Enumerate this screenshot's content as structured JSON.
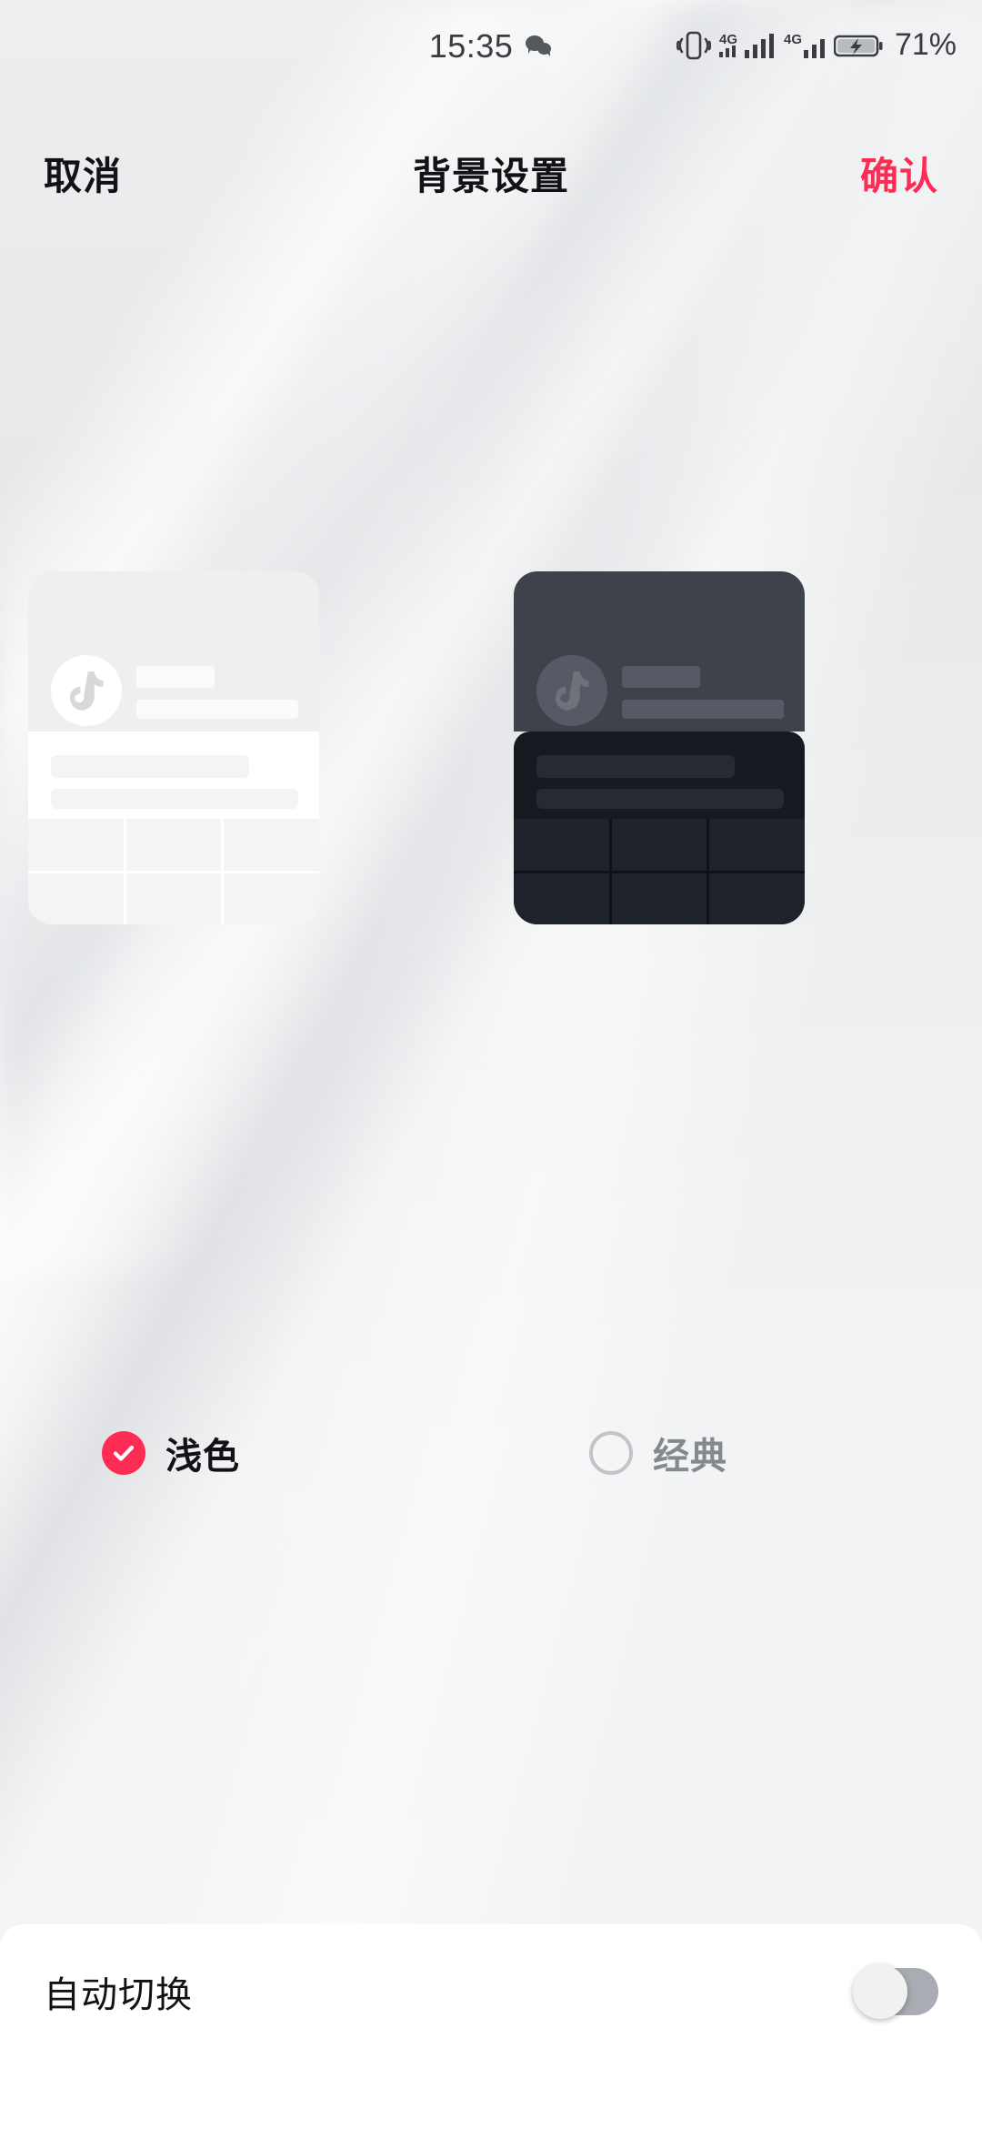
{
  "status_bar": {
    "time": "15:35",
    "battery_percent": "71%",
    "icons": [
      {
        "name": "wechat-icon"
      },
      {
        "name": "vibrate-icon"
      },
      {
        "name": "signal-4g-icon-1",
        "label": "4G"
      },
      {
        "name": "signal-4g-icon-2",
        "label": "4G"
      },
      {
        "name": "battery-charging-icon"
      }
    ]
  },
  "header": {
    "cancel_label": "取消",
    "title": "背景设置",
    "confirm_label": "确认",
    "confirm_color": "#fe2c55"
  },
  "themes": {
    "options": [
      {
        "id": "light",
        "label": "浅色",
        "selected": true,
        "preview_name": "light-theme-preview",
        "colors": {
          "header": "#efeff0",
          "body": "#ffffff",
          "grid_cell": "#f4f4f5",
          "avatar": "#ffffff",
          "placeholder": "#fbfbfb"
        }
      },
      {
        "id": "classic",
        "label": "经典",
        "selected": false,
        "preview_name": "classic-theme-preview",
        "colors": {
          "header": "#3e424b",
          "body": "#161920",
          "grid_cell": "#1e222a",
          "avatar": "#555a64",
          "placeholder": "#555a64"
        }
      }
    ],
    "selected_color": "#fe2c55",
    "unselected_color": "#c2c4c7"
  },
  "bottom_panel": {
    "auto_switch_label": "自动切换",
    "auto_switch_on": false
  }
}
